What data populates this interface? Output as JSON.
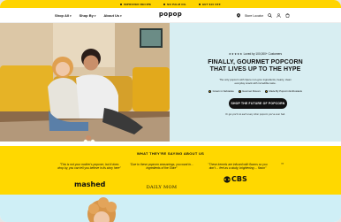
{
  "announcement": {
    "left": "IMPROVED RECIPE",
    "middle": "NO PALM OIL",
    "right": "GET $10 OFF"
  },
  "header": {
    "nav": [
      {
        "label": "Shop All"
      },
      {
        "label": "Shop By"
      },
      {
        "label": "About Us"
      }
    ],
    "logo": "popop",
    "store_locator": "Store Locator"
  },
  "hero": {
    "rating_text": "Loved by 100,000+ Customers",
    "stars": "★★★★★",
    "headline_line1": "FINALLY, GOURMET POPCORN",
    "headline_line2": "THAT LIVES UP TO THE HYPE",
    "subcopy": "The only popcorn with 3pure non-gmo ingredients, hearty, clean everyday snack with incredible taste.",
    "badges": [
      {
        "label": "Grown in Nebraska"
      },
      {
        "label": "Gourmet Flavors"
      },
      {
        "label": "Made By Popcorn Enthusiasts"
      }
    ],
    "cta_label": "SHOP THE FUTURE OF POPCORN",
    "cta_note": "Or get you'll cut each every other popcorn you've ever had."
  },
  "press": {
    "title": "WHAT THEY'RE SAYING ABOUT US",
    "quotes": [
      {
        "text": "\"This is not your mother's popcorn, but it does drop by, you can tell you believe in its story here\"",
        "brand": "mashed"
      },
      {
        "text": "\"Due to these popcorn seasonings, you want to... ingredients of the Shire\"",
        "brand": "DAILY MOM"
      },
      {
        "text": "\"These kernels are infused with flavors so you don't ... feel as a study, brightening ... flavor\"",
        "brand": "CBS"
      }
    ],
    "extra_mark": "\"\""
  },
  "colors": {
    "announcement_bg": "#ffd400",
    "hero_panel_bg": "#d8eef2",
    "press_bg": "#ffd800",
    "cta_bg": "#111111",
    "bottom_bg": "#cfeff6"
  },
  "icons": [
    "location-pin-icon",
    "search-icon",
    "account-icon",
    "cart-icon"
  ]
}
